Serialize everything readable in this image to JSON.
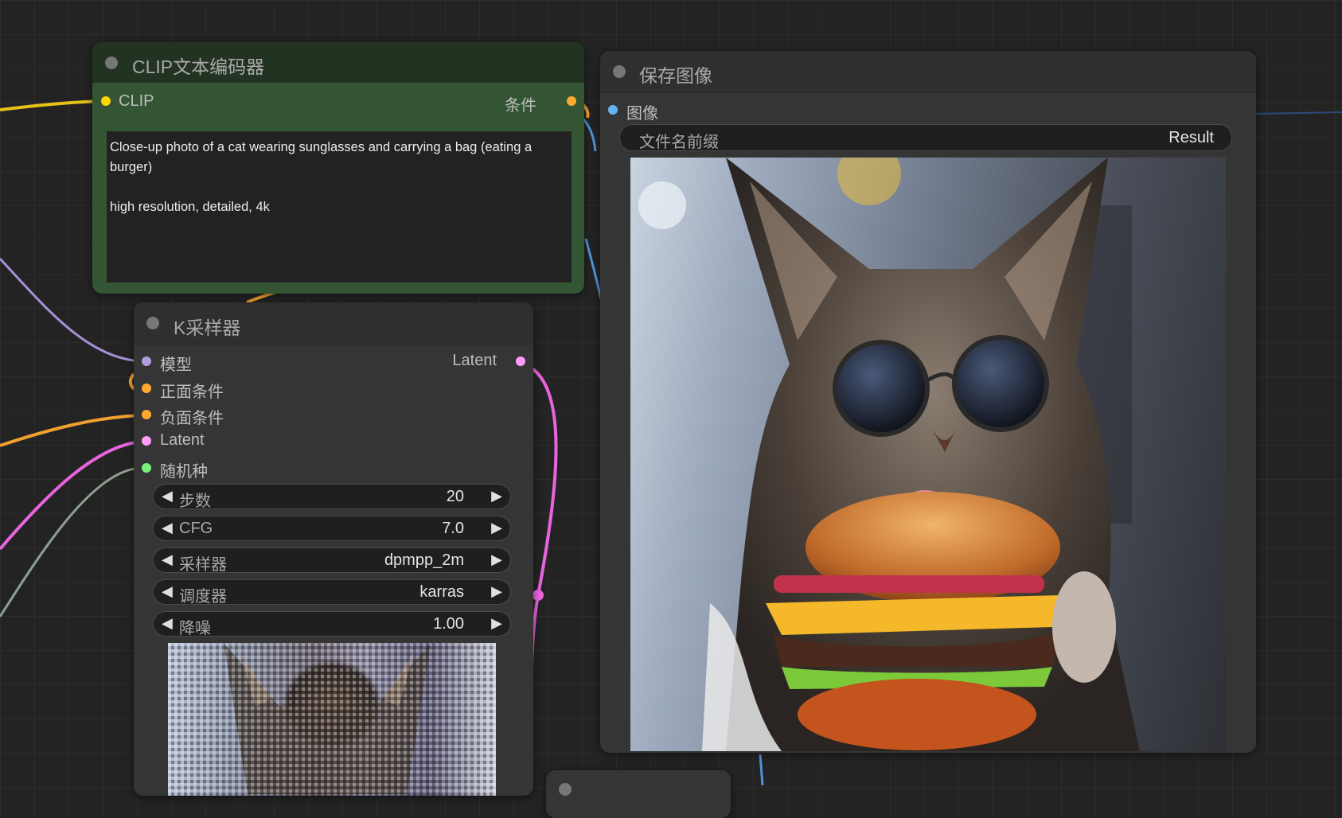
{
  "clip_node": {
    "title": "CLIP文本编码器",
    "input_label": "CLIP",
    "output_label": "条件",
    "prompt_text": "Close-up photo of a cat wearing sunglasses and carrying a bag (eating a burger)\n\nhigh resolution, detailed, 4k",
    "colors": {
      "body": "#335533",
      "header": "#223322"
    }
  },
  "save_node": {
    "title": "保存图像",
    "input_label": "图像",
    "prefix_label": "文件名前缀",
    "prefix_value": "Result",
    "image_description_icon": "cat-with-sunglasses-eating-burger"
  },
  "ksampler_node": {
    "title": "K采样器",
    "inputs": [
      "模型",
      "正面条件",
      "负面条件",
      "Latent",
      "随机种"
    ],
    "output_label": "Latent",
    "widgets": [
      {
        "label": "步数",
        "value": "20"
      },
      {
        "label": "CFG",
        "value": "7.0"
      },
      {
        "label": "采样器",
        "value": "dpmpp_2m"
      },
      {
        "label": "调度器",
        "value": "karras"
      },
      {
        "label": "降噪",
        "value": "1.00"
      }
    ]
  },
  "slot_colors": {
    "clip": "#ffd500",
    "conditioning": "#ffa931",
    "model": "#b39ddb",
    "latent": "#ff9cf9",
    "seed": "#7cf07c",
    "image": "#64b5f6"
  },
  "icons": {
    "left_arrow": "◀",
    "right_arrow": "▶"
  }
}
